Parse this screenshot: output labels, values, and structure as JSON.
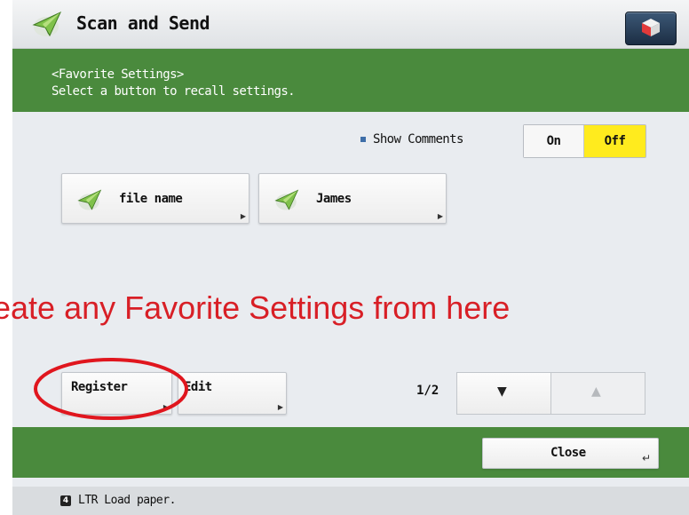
{
  "header": {
    "title": "Scan and Send",
    "app_icon": "paper-plane-icon",
    "home_icon": "cube-home-icon"
  },
  "message": {
    "line1": "<Favorite Settings>",
    "line2": "Select a button to recall settings."
  },
  "show_comments": {
    "label": "Show Comments",
    "on_label": "On",
    "off_label": "Off",
    "selected": "Off",
    "selected_color": "#ffeb1e"
  },
  "favorites": [
    {
      "label": "file name",
      "icon": "paper-plane-icon"
    },
    {
      "label": "James",
      "icon": "paper-plane-icon"
    }
  ],
  "actions": {
    "register_label": "Register",
    "edit_label": "Edit"
  },
  "pagination": {
    "indicator": "1/2",
    "down_icon": "triangle-down-icon",
    "up_icon": "triangle-up-icon"
  },
  "close_label": "Close",
  "status": {
    "icon_text": "4",
    "text": "LTR  Load paper."
  },
  "annotation": {
    "text": "eate any Favorite  Settings from here",
    "color": "#d81f26"
  },
  "colors": {
    "green_band": "#4a8a3d",
    "background": "#e9ecf0"
  }
}
